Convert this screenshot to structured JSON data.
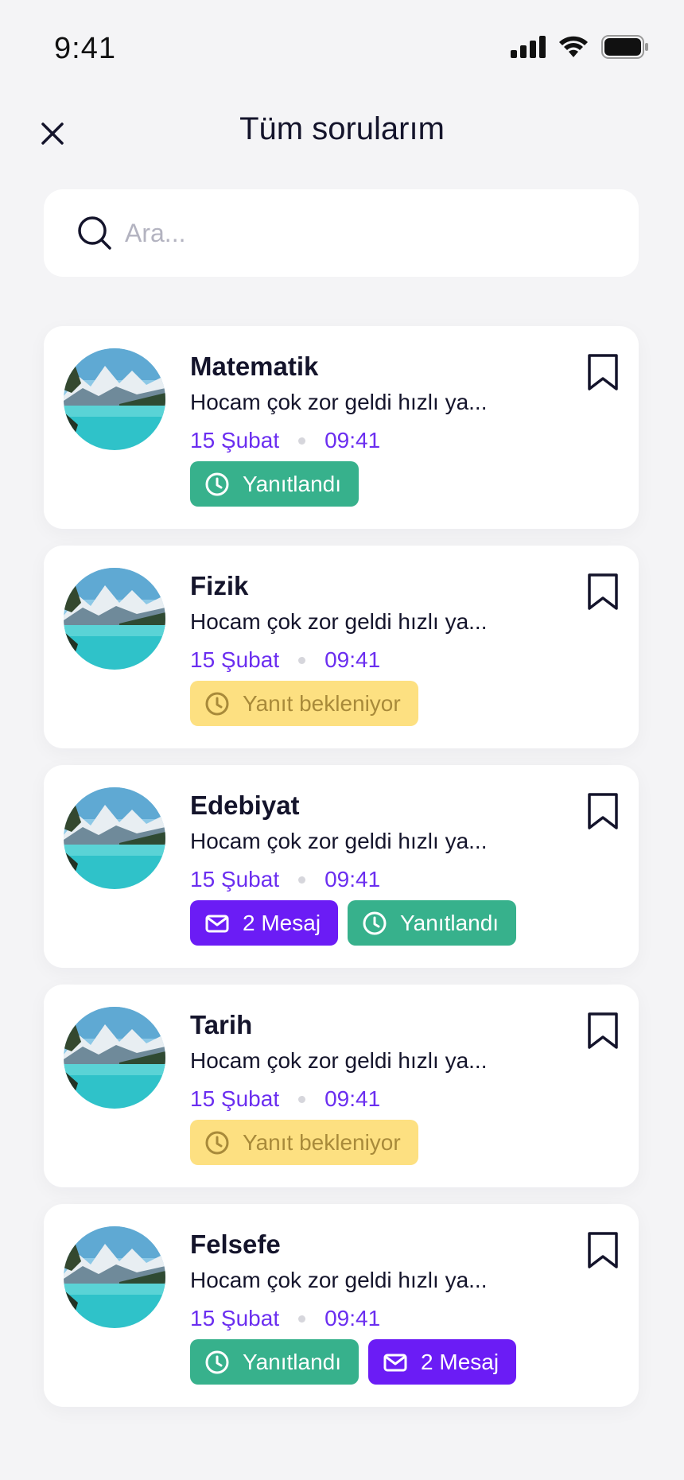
{
  "status": {
    "time": "9:41"
  },
  "header": {
    "title": "Tüm sorularım"
  },
  "search": {
    "placeholder": "Ara..."
  },
  "colors": {
    "accent": "#6b2ef0",
    "answered": "#37b18c",
    "waiting": "#fde081",
    "messages": "#6b1cf5"
  },
  "questions": [
    {
      "subject": "Matematik",
      "preview": "Hocam çok zor geldi hızlı ya...",
      "date": "15 Şubat",
      "time": "09:41",
      "badges": [
        {
          "type": "answered",
          "icon": "clock-icon",
          "label": "Yanıtlandı"
        }
      ]
    },
    {
      "subject": "Fizik",
      "preview": "Hocam çok zor geldi hızlı ya...",
      "date": "15 Şubat",
      "time": "09:41",
      "badges": [
        {
          "type": "waiting",
          "icon": "clock-icon",
          "label": "Yanıt bekleniyor"
        }
      ]
    },
    {
      "subject": "Edebiyat",
      "preview": "Hocam çok zor geldi hızlı ya...",
      "date": "15 Şubat",
      "time": "09:41",
      "badges": [
        {
          "type": "messages",
          "icon": "mail-icon",
          "label": "2 Mesaj"
        },
        {
          "type": "answered",
          "icon": "clock-icon",
          "label": "Yanıtlandı"
        }
      ]
    },
    {
      "subject": "Tarih",
      "preview": "Hocam çok zor geldi hızlı ya...",
      "date": "15 Şubat",
      "time": "09:41",
      "badges": [
        {
          "type": "waiting",
          "icon": "clock-icon",
          "label": "Yanıt bekleniyor"
        }
      ]
    },
    {
      "subject": "Felsefe",
      "preview": "Hocam çok zor geldi hızlı ya...",
      "date": "15 Şubat",
      "time": "09:41",
      "badges": [
        {
          "type": "answered",
          "icon": "clock-icon",
          "label": "Yanıtlandı"
        },
        {
          "type": "messages",
          "icon": "mail-icon",
          "label": "2 Mesaj"
        }
      ]
    }
  ]
}
